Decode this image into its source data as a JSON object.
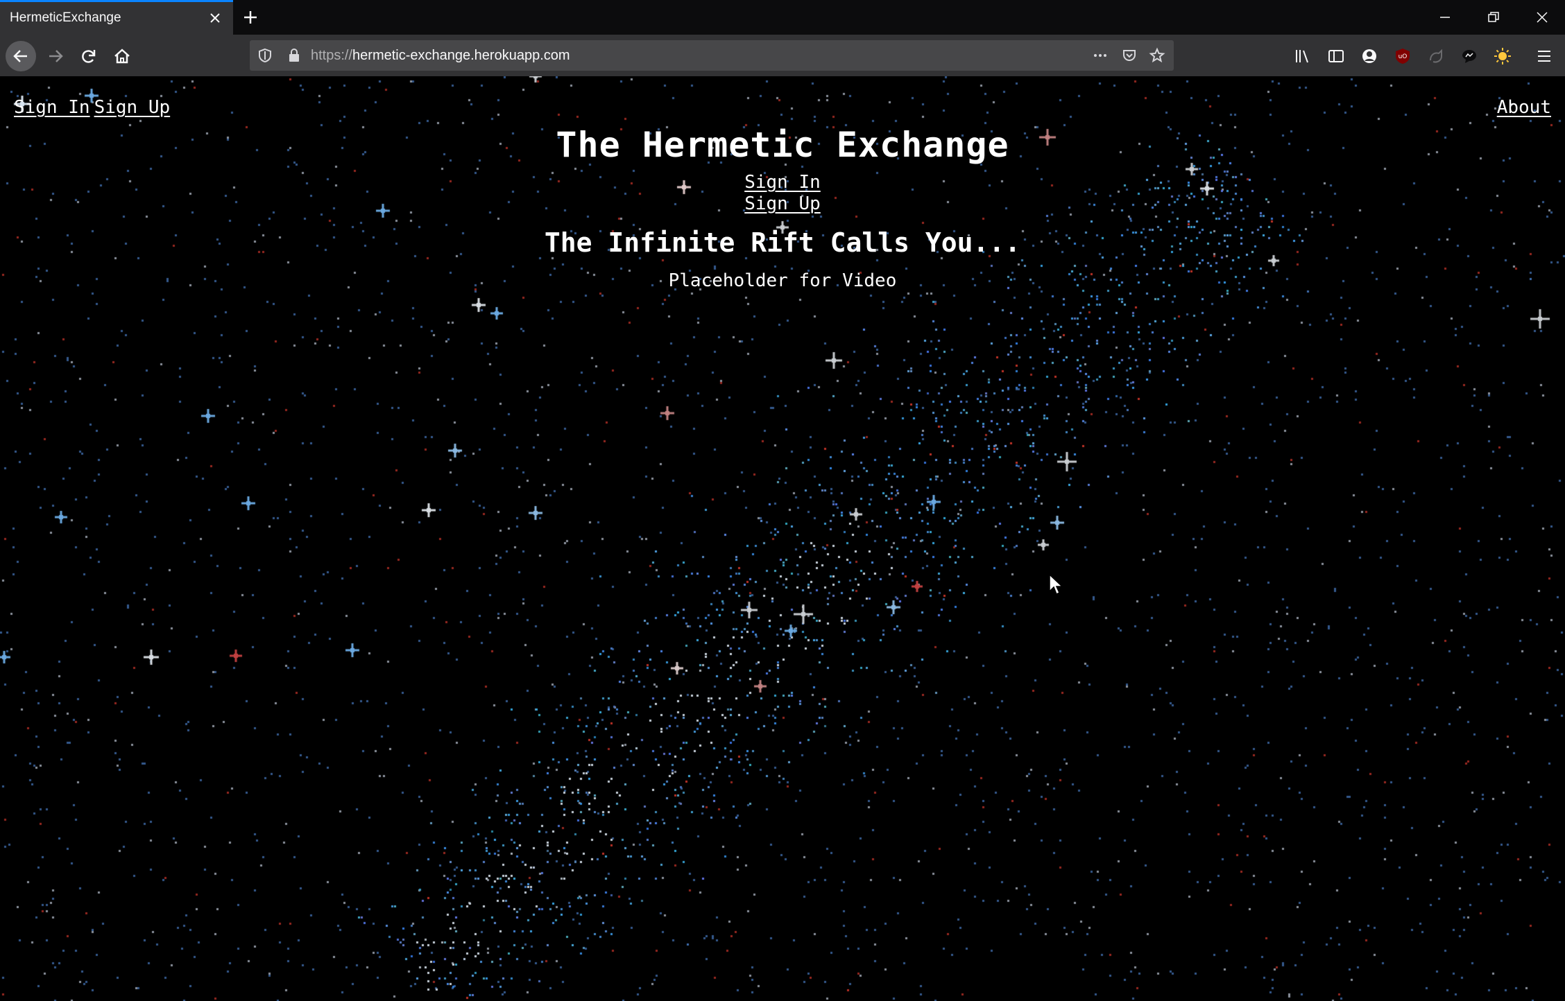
{
  "browser": {
    "tab_title": "HermeticExchange",
    "url_protocol": "https://",
    "url_host": "hermetic-exchange.herokuapp.com"
  },
  "nav": {
    "sign_in": "Sign In",
    "sign_up": "Sign Up",
    "about": "About"
  },
  "hero": {
    "title": "The Hermetic Exchange",
    "sign_in": "Sign In",
    "sign_up": "Sign Up",
    "tagline": "The Infinite Rift Calls You...",
    "video_placeholder": "Placeholder for Video"
  },
  "colors": {
    "background": "#000000",
    "text": "#ffffff",
    "star_blue": "#5b9bd5",
    "star_red": "#c0392b",
    "tab_accent": "#0a84ff"
  }
}
